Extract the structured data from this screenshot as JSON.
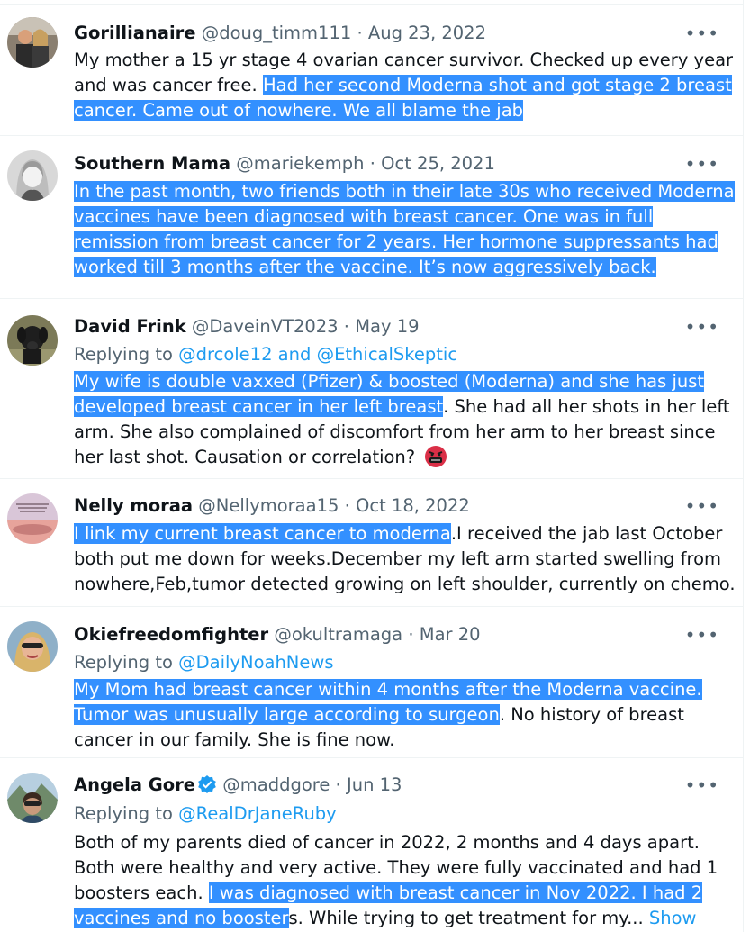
{
  "tweets": [
    {
      "name": "Gorillianaire",
      "handle": "@doug_timm111",
      "date": "Aug 23, 2022",
      "avatar_icon": "person-photo-icon",
      "body": [
        {
          "plain": "My mother a 15 yr stage 4 ovarian cancer survivor. Checked up every year"
        },
        {
          "plain": "and was cancer free. ",
          "hl": "Had her second Moderna shot and got stage 2 breast"
        },
        {
          "hl": "cancer. Came out of nowhere. We all blame the jab"
        }
      ]
    },
    {
      "name": "Southern Mama",
      "handle": "@mariekemph",
      "date": "Oct 25, 2021",
      "avatar_icon": "person-photo-icon",
      "body": [
        {
          "hl": "In the past month, two friends both in their late 30s who received Moderna"
        },
        {
          "hl": "vaccines have been diagnosed with breast cancer. One was in full"
        },
        {
          "hl": "remission from breast cancer for 2 years. Her hormone suppressants had"
        },
        {
          "hl": "worked till 3 months after the vaccine. It’s now aggressively back."
        }
      ]
    },
    {
      "name": "David Frink",
      "handle": "@DaveinVT2023",
      "date": "May 19",
      "avatar_icon": "dog-photo-icon",
      "reply_prefix": "Replying to ",
      "reply_to": "@drcole12 and @EthicalSkeptic",
      "body": [
        {
          "hl": "My wife is double vaxxed (Pfizer) & boosted (Moderna) and she has just"
        },
        {
          "hl": "developed breast cancer in her left breast",
          "plain2": ". She had all her shots in her left"
        },
        {
          "plain": "arm. She also complained of discomfort from her arm to her breast since"
        },
        {
          "plain": "her last shot. Causation or correlation? "
        }
      ],
      "emoji_icon": "angry-swearing-face-icon"
    },
    {
      "name": "Nelly moraa",
      "handle": "@Nellymoraa15",
      "date": "Oct 18, 2022",
      "avatar_icon": "quote-sunset-image-icon",
      "body": [
        {
          "hl": "I link my current breast cancer to moderna",
          "plain2": ".I received the jab last October"
        },
        {
          "plain": "both put me down for weeks.December my left arm started swelling from"
        },
        {
          "plain": "nowhere,Feb,tumor detected growing on left shoulder, currently on chemo."
        }
      ]
    },
    {
      "name": "Okiefreedomfighter",
      "handle": "@okultramaga",
      "date": "Mar 20",
      "avatar_icon": "person-sunglasses-photo-icon",
      "reply_prefix": "Replying to ",
      "reply_to": "@DailyNoahNews",
      "body": [
        {
          "hl": "My Mom had breast cancer within 4 months after the Moderna vaccine."
        },
        {
          "hl": "Tumor was unusually large according to surgeon",
          "plain2": ". No history of breast"
        },
        {
          "plain": "cancer in our family. She is fine now."
        }
      ]
    },
    {
      "name": "Angela Gore",
      "handle": "@maddgore",
      "date": "Jun 13",
      "avatar_icon": "person-mountain-photo-icon",
      "verified_icon": "verified-badge-icon",
      "reply_prefix": "Replying to ",
      "reply_to": "@RealDrJaneRuby",
      "body": [
        {
          "plain": "Both of my parents died of cancer in 2022, 2 months and 4 days apart."
        },
        {
          "plain": "Both were healthy and very active. They were fully vaccinated and had 1"
        },
        {
          "plain": "boosters each. ",
          "hl": "I was diagnosed with breast cancer in Nov 2022. I had 2"
        },
        {
          "hl": "vaccines and no booster",
          "plain2": "s. While trying to get treatment for my... "
        }
      ],
      "show_more": "Show"
    }
  ],
  "separator": " · ",
  "more_label": "•••",
  "colors": {
    "highlight": "#3390ff",
    "link": "#1d9bf0",
    "muted": "#536471",
    "text": "#0f1419"
  }
}
